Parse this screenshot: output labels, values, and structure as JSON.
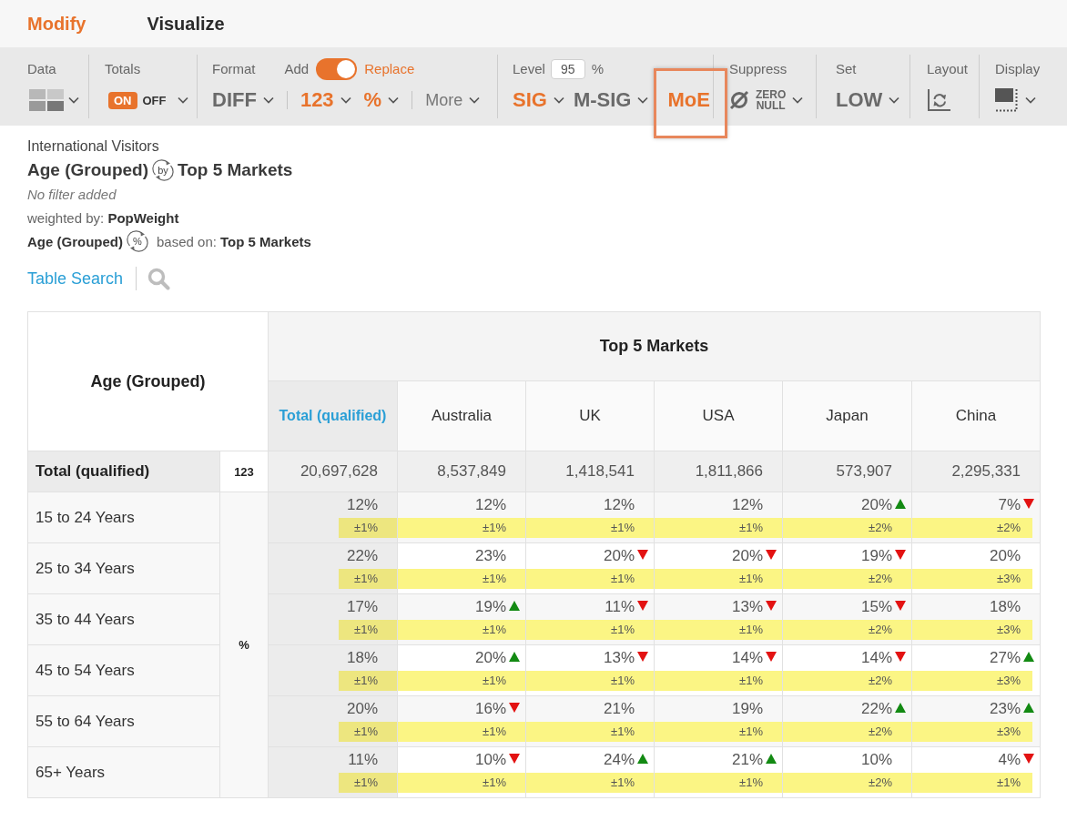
{
  "tabs": [
    {
      "label": "Modify",
      "selected": true
    },
    {
      "label": "Visualize",
      "selected": false
    }
  ],
  "toolbar": {
    "data": {
      "label": "Data"
    },
    "totals": {
      "label": "Totals",
      "options": [
        {
          "label": "ON",
          "selected": true
        },
        {
          "label": "OFF",
          "selected": false
        }
      ]
    },
    "format": {
      "label": "Format",
      "mode_labels": [
        "Add",
        "Replace"
      ],
      "replace": true,
      "option_groups": [
        {
          "options": [
            {
              "label": "DIFF",
              "kind": "value",
              "active": false
            }
          ]
        },
        {
          "options": [
            {
              "label": "123",
              "kind": "value",
              "active": true
            },
            {
              "label": "%",
              "kind": "value",
              "active": true
            }
          ]
        },
        {
          "options": [
            {
              "label": "More",
              "kind": "menu",
              "active": false
            }
          ]
        }
      ]
    },
    "level": {
      "label": "Level",
      "value": "95",
      "unit": "%",
      "tests": [
        {
          "label": "SIG",
          "active": true,
          "dropdown": true,
          "highlighted": false
        },
        {
          "label": "M-SIG",
          "active": false,
          "dropdown": true,
          "highlighted": false
        },
        {
          "label": "MoE",
          "active": true,
          "dropdown": false,
          "highlighted": true
        }
      ]
    },
    "suppress": {
      "label": "Suppress",
      "lines": [
        "ZERO",
        "NULL"
      ]
    },
    "set": {
      "label": "Set",
      "value": "LOW"
    },
    "layout": {
      "label": "Layout"
    },
    "display": {
      "label": "Display"
    }
  },
  "info": {
    "source": "International Visitors",
    "row_variable": "Age (Grouped)",
    "swap_label": "by",
    "column_variable": "Top 5 Markets",
    "filter": "No filter added",
    "weighting": "weighted by: **PopWeight**",
    "base_variable": "Age (Grouped)",
    "base_swap_label": "%",
    "base_text": "based on: **Top 5 Markets**"
  },
  "search": {
    "label": "Table Search"
  },
  "table": {
    "corner": "Age (Grouped)",
    "banner": "Top 5 Markets",
    "columns": [
      {
        "label": "Total (qualified)",
        "kind": "total"
      },
      {
        "label": "Australia",
        "kind": "market"
      },
      {
        "label": "UK",
        "kind": "market"
      },
      {
        "label": "USA",
        "kind": "market"
      },
      {
        "label": "Japan",
        "kind": "market"
      },
      {
        "label": "China",
        "kind": "market"
      }
    ],
    "total_row": {
      "label": "Total (qualified)",
      "stat": "123",
      "values": [
        "20,697,628",
        "8,537,849",
        "1,418,541",
        "1,811,866",
        "573,907",
        "2,295,331"
      ]
    },
    "stat_label": "%",
    "rows": [
      {
        "label": "15 to 24 Years",
        "cells": [
          {
            "value": "12%",
            "kind": "plain",
            "moe": "±1%"
          },
          {
            "value": "12%",
            "kind": "plain",
            "moe": "±1%"
          },
          {
            "value": "12%",
            "kind": "plain",
            "moe": "±1%"
          },
          {
            "value": "12%",
            "kind": "plain",
            "moe": "±1%"
          },
          {
            "value": "20%",
            "kind": "higher",
            "moe": "±2%"
          },
          {
            "value": "7%",
            "kind": "lower",
            "moe": "±2%"
          }
        ]
      },
      {
        "label": "25 to 34 Years",
        "cells": [
          {
            "value": "22%",
            "kind": "plain",
            "moe": "±1%"
          },
          {
            "value": "23%",
            "kind": "plain",
            "moe": "±1%"
          },
          {
            "value": "20%",
            "kind": "lower",
            "moe": "±1%"
          },
          {
            "value": "20%",
            "kind": "lower",
            "moe": "±1%"
          },
          {
            "value": "19%",
            "kind": "lower",
            "moe": "±2%"
          },
          {
            "value": "20%",
            "kind": "plain",
            "moe": "±3%"
          }
        ]
      },
      {
        "label": "35 to 44 Years",
        "cells": [
          {
            "value": "17%",
            "kind": "plain",
            "moe": "±1%"
          },
          {
            "value": "19%",
            "kind": "higher",
            "moe": "±1%"
          },
          {
            "value": "11%",
            "kind": "lower",
            "moe": "±1%"
          },
          {
            "value": "13%",
            "kind": "lower",
            "moe": "±1%"
          },
          {
            "value": "15%",
            "kind": "lower",
            "moe": "±2%"
          },
          {
            "value": "18%",
            "kind": "plain",
            "moe": "±3%"
          }
        ]
      },
      {
        "label": "45 to 54 Years",
        "cells": [
          {
            "value": "18%",
            "kind": "plain",
            "moe": "±1%"
          },
          {
            "value": "20%",
            "kind": "higher",
            "moe": "±1%"
          },
          {
            "value": "13%",
            "kind": "lower",
            "moe": "±1%"
          },
          {
            "value": "14%",
            "kind": "lower",
            "moe": "±1%"
          },
          {
            "value": "14%",
            "kind": "lower",
            "moe": "±2%"
          },
          {
            "value": "27%",
            "kind": "higher",
            "moe": "±3%"
          }
        ]
      },
      {
        "label": "55 to 64 Years",
        "cells": [
          {
            "value": "20%",
            "kind": "plain",
            "moe": "±1%"
          },
          {
            "value": "16%",
            "kind": "lower",
            "moe": "±1%"
          },
          {
            "value": "21%",
            "kind": "plain",
            "moe": "±1%"
          },
          {
            "value": "19%",
            "kind": "plain",
            "moe": "±1%"
          },
          {
            "value": "22%",
            "kind": "higher",
            "moe": "±2%"
          },
          {
            "value": "23%",
            "kind": "higher",
            "moe": "±3%"
          }
        ]
      },
      {
        "label": "65+ Years",
        "cells": [
          {
            "value": "11%",
            "kind": "plain",
            "moe": "±1%"
          },
          {
            "value": "10%",
            "kind": "lower",
            "moe": "±1%"
          },
          {
            "value": "24%",
            "kind": "higher",
            "moe": "±1%"
          },
          {
            "value": "21%",
            "kind": "higher",
            "moe": "±1%"
          },
          {
            "value": "10%",
            "kind": "plain",
            "moe": "±2%"
          },
          {
            "value": "4%",
            "kind": "lower",
            "moe": "±1%"
          }
        ]
      }
    ]
  }
}
